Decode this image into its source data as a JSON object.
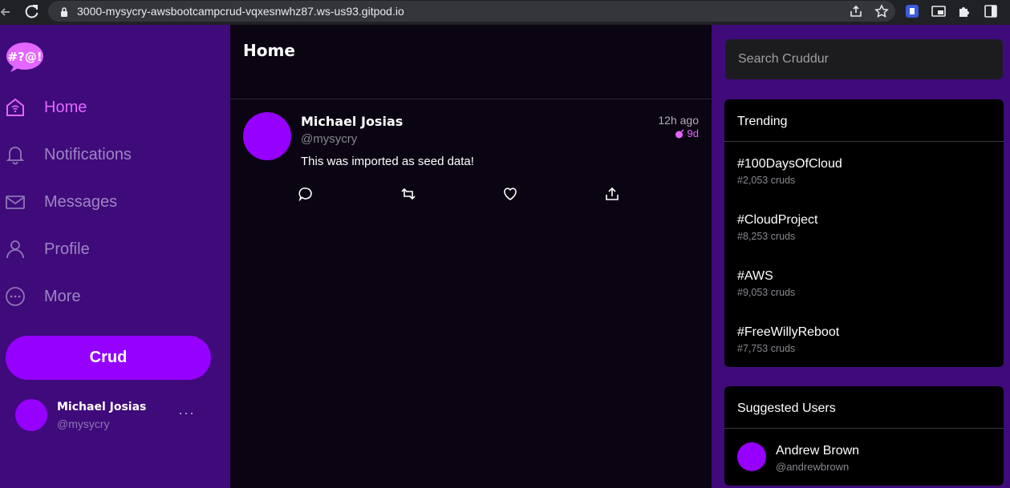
{
  "browser": {
    "url": "3000-mysycry-awsbootcampcrud-vqxesnwhz87.ws-us93.gitpod.io"
  },
  "nav": {
    "logo_text": "#?@!",
    "items": [
      {
        "label": "Home",
        "icon": "home-icon",
        "active": true
      },
      {
        "label": "Notifications",
        "icon": "bell-icon"
      },
      {
        "label": "Messages",
        "icon": "envelope-icon"
      },
      {
        "label": "Profile",
        "icon": "user-icon"
      },
      {
        "label": "More",
        "icon": "ellipsis-circle-icon"
      }
    ],
    "crud_button": "Crud",
    "profile": {
      "name": "Michael Josias",
      "handle": "@mysycry",
      "more": "···"
    }
  },
  "feed": {
    "title": "Home",
    "posts": [
      {
        "name": "Michael Josias",
        "handle": "@mysycry",
        "time": "12h ago",
        "expires": "9d",
        "body": "This was imported as seed data!"
      }
    ]
  },
  "search": {
    "placeholder": "Search Cruddur"
  },
  "trending": {
    "title": "Trending",
    "items": [
      {
        "tag": "#100DaysOfCloud",
        "count": "#2,053 cruds"
      },
      {
        "tag": "#CloudProject",
        "count": "#8,253 cruds"
      },
      {
        "tag": "#AWS",
        "count": "#9,053 cruds"
      },
      {
        "tag": "#FreeWillyReboot",
        "count": "#7,753 cruds"
      }
    ]
  },
  "suggested": {
    "title": "Suggested Users",
    "users": [
      {
        "name": "Andrew Brown",
        "handle": "@andrewbrown"
      }
    ]
  },
  "colors": {
    "sidebar_bg": "#3f0a7a",
    "feed_bg": "#0b0412",
    "accent": "#9500ff",
    "active": "#e266ff"
  }
}
